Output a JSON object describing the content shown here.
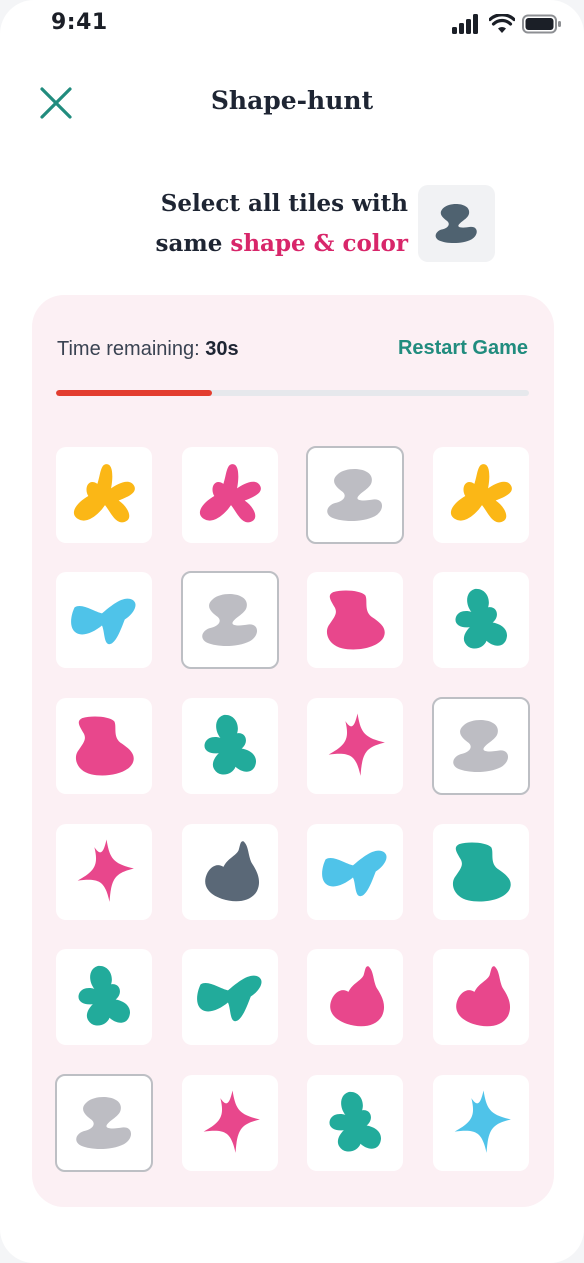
{
  "status": {
    "time": "9:41"
  },
  "header": {
    "title": "Shape-hunt"
  },
  "instruction": {
    "line1": "Select all tiles with",
    "line2_prefix": "same ",
    "line2_highlight": "shape & color"
  },
  "target": {
    "shape": "s-blob",
    "color": "#4f6270"
  },
  "timer": {
    "label": "Time remaining: ",
    "value": "30s",
    "progress": 0.33
  },
  "restart_label": "Restart Game",
  "colors": {
    "yellow": "#fbb716",
    "pink": "#e8478c",
    "gray": "#bdbdc3",
    "blue": "#4fc3e9",
    "teal": "#22ab9b",
    "slate": "#5a6877",
    "accent_pink": "#d8266a",
    "accent_teal": "#218c7e",
    "timer_red": "#e33d2f"
  },
  "tiles": [
    {
      "shape": "fan",
      "color": "yellow",
      "selected": false
    },
    {
      "shape": "fan",
      "color": "pink",
      "selected": false
    },
    {
      "shape": "s-blob",
      "color": "gray",
      "selected": true
    },
    {
      "shape": "fan",
      "color": "yellow",
      "selected": false
    },
    {
      "shape": "bow",
      "color": "blue",
      "selected": false
    },
    {
      "shape": "s-blob",
      "color": "gray",
      "selected": true
    },
    {
      "shape": "boot",
      "color": "pink",
      "selected": false
    },
    {
      "shape": "clover",
      "color": "teal",
      "selected": false
    },
    {
      "shape": "boot",
      "color": "pink",
      "selected": false
    },
    {
      "shape": "clover",
      "color": "teal",
      "selected": false
    },
    {
      "shape": "star",
      "color": "pink",
      "selected": false
    },
    {
      "shape": "s-blob",
      "color": "gray",
      "selected": true
    },
    {
      "shape": "star",
      "color": "pink",
      "selected": false
    },
    {
      "shape": "heart",
      "color": "slate",
      "selected": false
    },
    {
      "shape": "bow",
      "color": "blue",
      "selected": false
    },
    {
      "shape": "boot",
      "color": "teal",
      "selected": false
    },
    {
      "shape": "clover",
      "color": "teal",
      "selected": false
    },
    {
      "shape": "bow",
      "color": "teal",
      "selected": false
    },
    {
      "shape": "heart",
      "color": "pink",
      "selected": false
    },
    {
      "shape": "heart",
      "color": "pink",
      "selected": false
    },
    {
      "shape": "s-blob",
      "color": "gray",
      "selected": true
    },
    {
      "shape": "star",
      "color": "pink",
      "selected": false
    },
    {
      "shape": "clover",
      "color": "teal",
      "selected": false
    },
    {
      "shape": "star",
      "color": "blue",
      "selected": false
    }
  ]
}
